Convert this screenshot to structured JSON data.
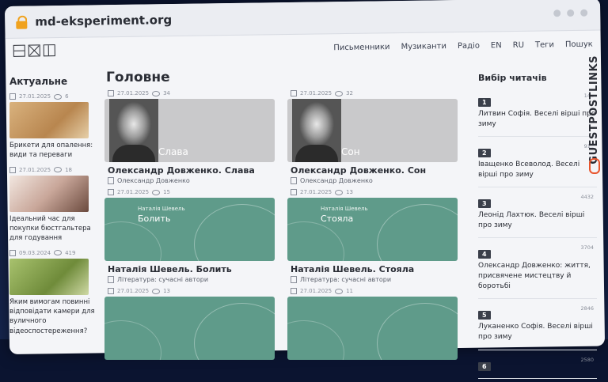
{
  "browser": {
    "url": "md-eksperiment.org"
  },
  "nav": {
    "items": [
      "Письменники",
      "Музиканти",
      "Радіо",
      "EN",
      "RU",
      "Теги",
      "Пошук"
    ]
  },
  "left": {
    "title": "Актуальне",
    "items": [
      {
        "date": "27.01.2025",
        "views": "6",
        "text": "Брикети для опалення: види та переваги"
      },
      {
        "date": "27.01.2025",
        "views": "18",
        "text": "Ідеальний час для покупки бюстгальтера для годування"
      },
      {
        "date": "09.03.2024",
        "views": "419",
        "text": "Яким вимогам повинні відповідати камери для вуличного відеоспостереження?"
      }
    ]
  },
  "main": {
    "title": "Головне",
    "cards": [
      {
        "date": "27.01.2025",
        "views": "34",
        "img_title": "Слава",
        "img_author": "",
        "title": "Олександр Довженко. Слава",
        "author": "Олександр Довженко"
      },
      {
        "date": "27.01.2025",
        "views": "32",
        "img_title": "Сон",
        "img_author": "",
        "title": "Олександр Довженко. Сон",
        "author": "Олександр Довженко"
      },
      {
        "date": "27.01.2025",
        "views": "15",
        "img_title": "Болить",
        "img_author": "Наталія Шевель",
        "title": "Наталія Шевель. Болить",
        "author": "Література: сучасні автори"
      },
      {
        "date": "27.01.2025",
        "views": "13",
        "img_title": "Стояла",
        "img_author": "Наталія Шевель",
        "title": "Наталія Шевель. Стояла",
        "author": "Література: сучасні автори"
      },
      {
        "date": "27.01.2025",
        "views": "13"
      },
      {
        "date": "27.01.2025",
        "views": "11"
      }
    ]
  },
  "right": {
    "title": "Вибір читачів",
    "items": [
      {
        "num": "1",
        "views": "14..",
        "text": "Литвин Софія. Веселі вірші про зиму"
      },
      {
        "num": "2",
        "views": "91..",
        "text": "Іващенко Всеволод. Веселі вірші про зиму"
      },
      {
        "num": "3",
        "views": "4432",
        "text": "Леонід Лахтюк. Веселі вірші про зиму"
      },
      {
        "num": "4",
        "views": "3704",
        "text": "Олександр Довженко: життя, присвячене мистецтву й боротьбі"
      },
      {
        "num": "5",
        "views": "2846",
        "text": "Луканенко Софія. Веселі вірші про зиму"
      },
      {
        "num": "6",
        "views": "2580",
        "text": ""
      }
    ]
  },
  "watermark": {
    "text": "GUESTPOSTLINKS"
  }
}
